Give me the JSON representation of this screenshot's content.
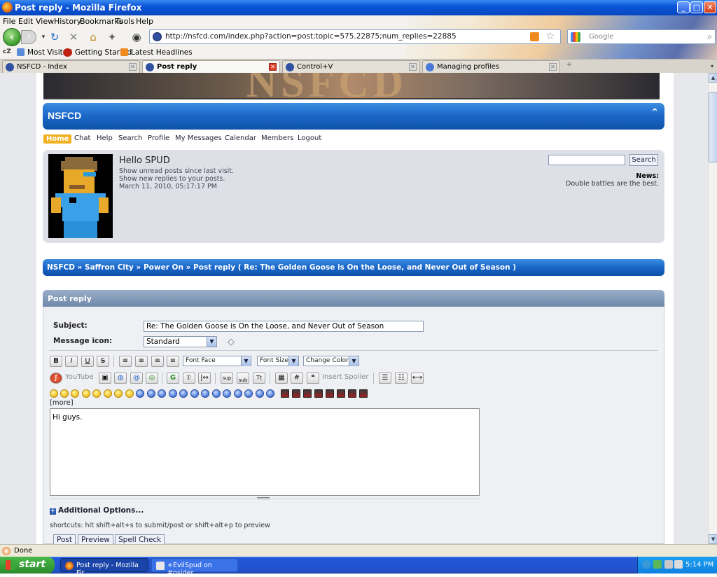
{
  "window": {
    "title": "Post reply - Mozilla Firefox",
    "min": "_",
    "max": "□",
    "close": "✕"
  },
  "menubar": [
    "File",
    "Edit",
    "View",
    "History",
    "Bookmarks",
    "Tools",
    "Help"
  ],
  "nav": {
    "url": "http://nsfcd.com/index.php?action=post;topic=575.22875;num_replies=22885",
    "search_placeholder": "Google"
  },
  "bookmarks": [
    "Most Visited",
    "Getting Started",
    "Latest Headlines"
  ],
  "tabs": [
    {
      "label": "NSFCD - Index",
      "active": false
    },
    {
      "label": "Post reply",
      "active": true
    },
    {
      "label": "Control+V",
      "active": false
    },
    {
      "label": "Managing profiles",
      "active": false
    }
  ],
  "forum": {
    "title": "NSFCD",
    "nav": [
      "Home",
      "Chat",
      "Help",
      "Search",
      "Profile",
      "My Messages",
      "Calendar",
      "Members",
      "Logout"
    ],
    "user": {
      "greeting": "Hello SPUD",
      "line1": "Show unread posts since last visit.",
      "line2": "Show new replies to your posts.",
      "date": "March 11, 2010, 05:17:17 PM",
      "search_button": "Search",
      "news_label": "News:",
      "news_text": "Double battles are the best."
    },
    "breadcrumb": "NSFCD » Saffron City » Power On » Post reply ( Re: The Golden Goose is On the Loose, and Never Out of Season )",
    "post": {
      "header": "Post reply",
      "subject_label": "Subject:",
      "subject_value": "Re: The Golden Goose is On the Loose, and Never Out of Season",
      "icon_label": "Message icon:",
      "icon_value": "Standard",
      "font_face": "Font Face",
      "font_size": "Font Size",
      "change_color": "Change Color",
      "youtube": "YouTube",
      "insert_spoiler": "Insert Spoiler",
      "more": "[more]",
      "message": "Hi guys.",
      "additional": "Additional Options...",
      "shortcuts": "shortcuts: hit shift+alt+s to submit/post or shift+alt+p to preview",
      "buttons": [
        "Post",
        "Preview",
        "Spell Check"
      ]
    }
  },
  "status": "Done",
  "taskbar": {
    "start": "start",
    "tasks": [
      "Post reply - Mozilla Fir...",
      "+EvilSpud on #nsider..."
    ],
    "clock": "5:14 PM"
  }
}
